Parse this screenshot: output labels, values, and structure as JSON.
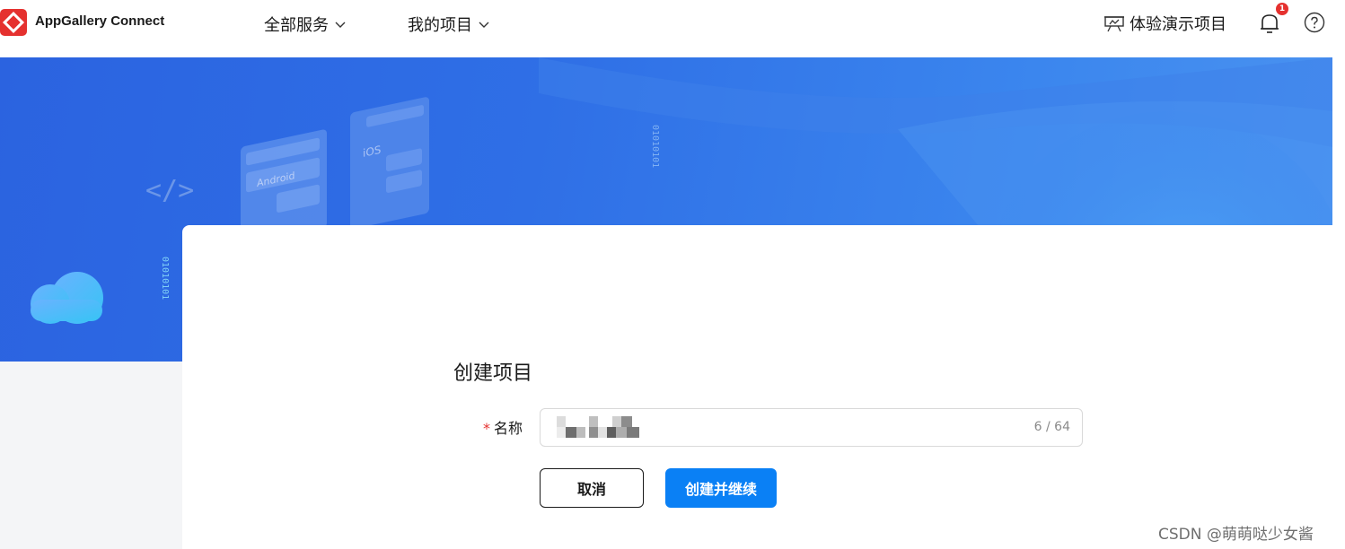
{
  "header": {
    "app_name": "AppGallery Connect",
    "nav": [
      {
        "label": "全部服务"
      },
      {
        "label": "我的项目"
      }
    ],
    "demo_label": "体验演示项目",
    "notification_count": "1"
  },
  "banner": {
    "android_label": "Android",
    "ios_label": "iOS",
    "binary_text": "01010101",
    "code_glyph": "</>"
  },
  "form": {
    "title": "创建项目",
    "required_mark": "*",
    "name_label": "名称",
    "name_counter": "6 / 64",
    "cancel_label": "取消",
    "create_label": "创建并继续"
  },
  "watermark": "CSDN @萌萌哒少女酱",
  "colors": {
    "brand_red": "#e5312f",
    "primary_blue": "#0a80f5",
    "banner_blue": "#2f6fe6"
  }
}
